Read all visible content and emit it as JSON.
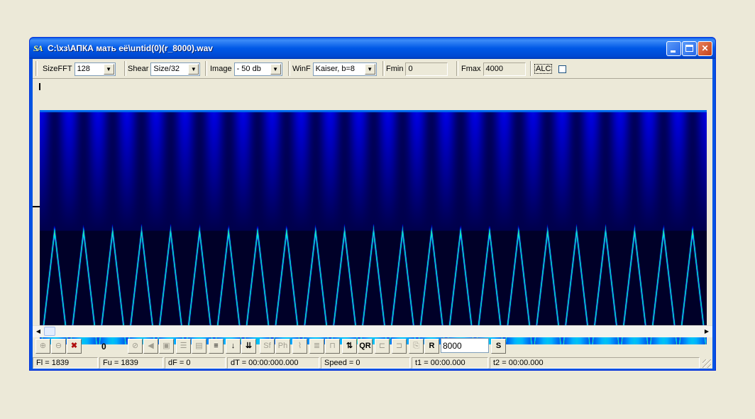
{
  "window": {
    "title": "C:\\хз\\АПКА мать её\\untid(0)(r_8000).wav",
    "icon": "SA",
    "controls": [
      "minimize-icon",
      "maximize-icon",
      "close-icon"
    ]
  },
  "toolbar": {
    "sizefft": {
      "label": "SizeFFT",
      "value": "128"
    },
    "shear": {
      "label": "Shear",
      "value": "Size/32"
    },
    "image": {
      "label": "Image",
      "value": "- 50 db"
    },
    "winf": {
      "label": "WinF",
      "value": "Kaiser, b=8"
    },
    "fmin": {
      "label": "Fmin",
      "value": "0"
    },
    "fmax": {
      "label": "Fmax",
      "value": "4000"
    },
    "alc": {
      "label": "ALC",
      "checked": false
    }
  },
  "spectrogram": {
    "colormap": "blue-cyan-green jet",
    "periods": 23,
    "background": "#000033"
  },
  "buttons": {
    "counter": "0",
    "rate_button": "R",
    "rate_value": "8000",
    "s_button": "S",
    "sf_label": "Sf",
    "ph_label": "Ph",
    "qr_label": "QR"
  },
  "status": {
    "fl": "Fl = 1839",
    "fu": "Fu = 1839",
    "df": "dF = 0",
    "dt": "dT = 00:00:000.000",
    "speed": "Speed = 0",
    "t1": "t1 = 00:00.000",
    "t2": "t2 = 00:00.000"
  }
}
